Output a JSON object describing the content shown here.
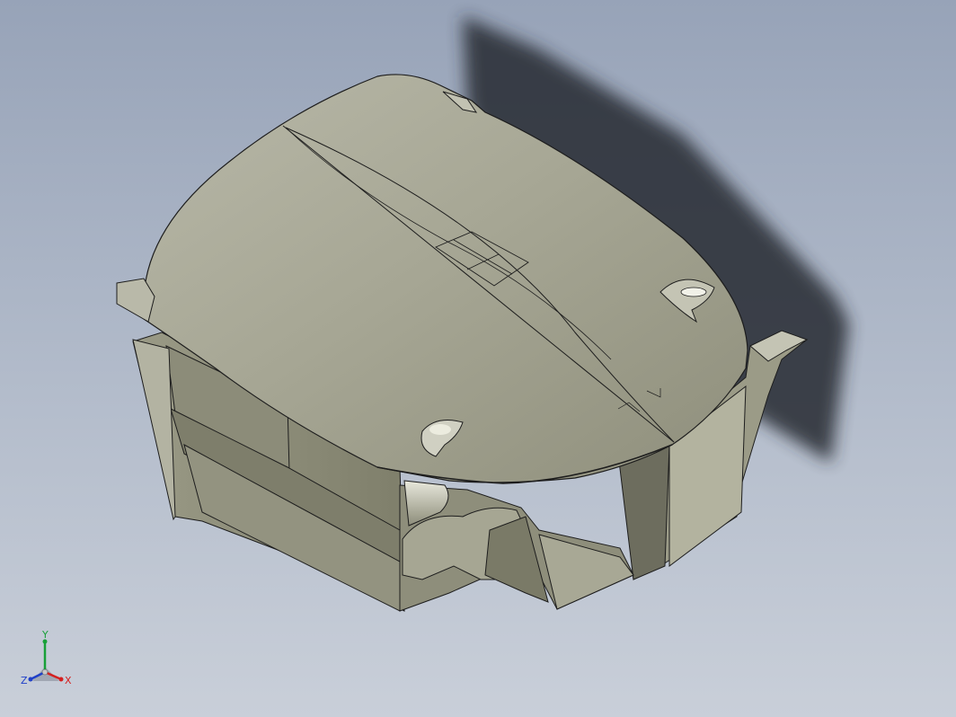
{
  "viewport": {
    "background_top": "#97a3b8",
    "background_bottom": "#c9cfd9"
  },
  "model": {
    "body_color": "#a3a390",
    "shadow_color": "#2c313a",
    "edge_color": "#1d1d1d"
  },
  "triad": {
    "x_label": "X",
    "y_label": "Y",
    "z_label": "Z",
    "x_color": "#d42020",
    "y_color": "#18a038",
    "z_color": "#2040c8"
  }
}
